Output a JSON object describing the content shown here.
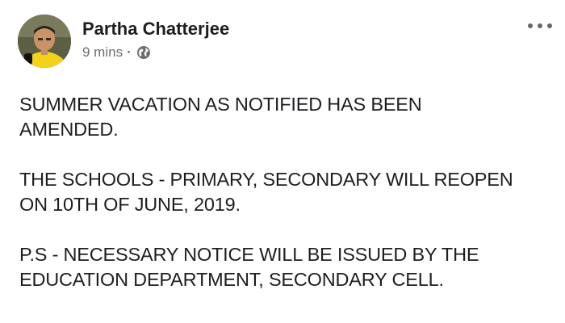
{
  "post": {
    "author": {
      "name": "Partha Chatterjee",
      "avatar_icon": "profile-photo"
    },
    "timestamp": "9 mins",
    "separator": "·",
    "privacy_icon": "globe-icon",
    "more_icon": "more-options-icon",
    "paragraphs": [
      "SUMMER VACATION AS NOTIFIED HAS BEEN\nAMENDED.",
      "THE SCHOOLS - PRIMARY, SECONDARY WILL REOPEN\nON 10TH OF JUNE, 2019.",
      "P.S - NECESSARY NOTICE WILL BE ISSUED BY THE\nEDUCATION DEPARTMENT, SECONDARY CELL."
    ]
  },
  "colors": {
    "text_primary": "#1c1e21",
    "text_secondary": "#6b6e73",
    "background": "#ffffff"
  }
}
